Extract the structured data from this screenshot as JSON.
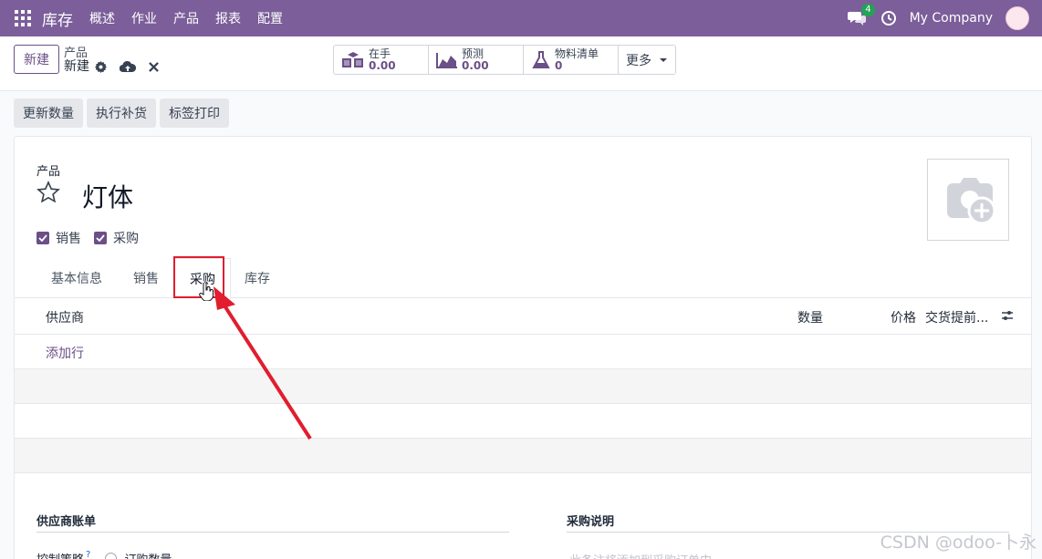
{
  "nav": {
    "app_name": "库存",
    "menu": [
      "概述",
      "作业",
      "产品",
      "报表",
      "配置"
    ],
    "chat_count": "4",
    "company": "My Company"
  },
  "control": {
    "new_label": "新建",
    "breadcrumb_parent": "产品",
    "breadcrumb_current": "新建",
    "stats": [
      {
        "label": "在手",
        "value": "0.00",
        "icon": "cubes-icon"
      },
      {
        "label": "预测",
        "value": "0.00",
        "icon": "area-chart-icon"
      },
      {
        "label": "物料清单",
        "value": "0",
        "icon": "flask-icon"
      }
    ],
    "more_label": "更多"
  },
  "actions": [
    "更新数量",
    "执行补货",
    "标签打印"
  ],
  "form": {
    "product_label": "产品",
    "product_name": "灯体",
    "checkbox_sale": "销售",
    "checkbox_purchase": "采购",
    "tabs": [
      "基本信息",
      "销售",
      "采购",
      "库存"
    ],
    "active_tab": "采购",
    "columns": {
      "vendor": "供应商",
      "quantity": "数量",
      "price": "价格",
      "lead_time": "交货提前..."
    },
    "add_line": "添加行",
    "section_vendor_bills": "供应商账单",
    "section_purchase_desc": "采购说明",
    "control_policy_label": "控制策略",
    "control_policy_help": "?",
    "control_policy_option": "订购数量",
    "purchase_desc_placeholder": "此备注将添加到采购订单中"
  },
  "watermark": "CSDN @odoo-卜永",
  "colors": {
    "navbar": "#7b5e9a",
    "accent": "#6b4f86",
    "annotation": "#e11d2e"
  }
}
